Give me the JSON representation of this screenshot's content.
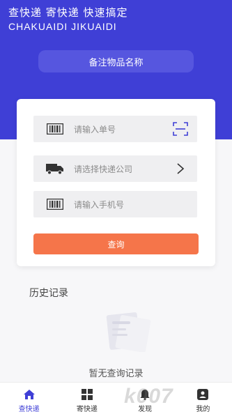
{
  "header": {
    "title": "查快递  寄快递  快速搞定",
    "subtitle": "CHAKUAIDI  JIKUAIDI",
    "note_button": "备注物品名称"
  },
  "form": {
    "tracking_placeholder": "请输入单号",
    "company_placeholder": "请选择快递公司",
    "phone_placeholder": "请输入手机号",
    "query_button": "查询"
  },
  "history": {
    "title": "历史记录",
    "empty_text": "暂无查询记录"
  },
  "tabbar": {
    "items": [
      {
        "label": "查快递",
        "icon": "home-icon",
        "active": true
      },
      {
        "label": "寄快递",
        "icon": "grid-icon",
        "active": false
      },
      {
        "label": "发现",
        "icon": "discover-icon",
        "active": false
      },
      {
        "label": "我的",
        "icon": "profile-icon",
        "active": false
      }
    ]
  },
  "watermark": "k007",
  "colors": {
    "brand": "#3f3fd6",
    "button": "#f5754a",
    "field_bg": "#efeff1"
  }
}
